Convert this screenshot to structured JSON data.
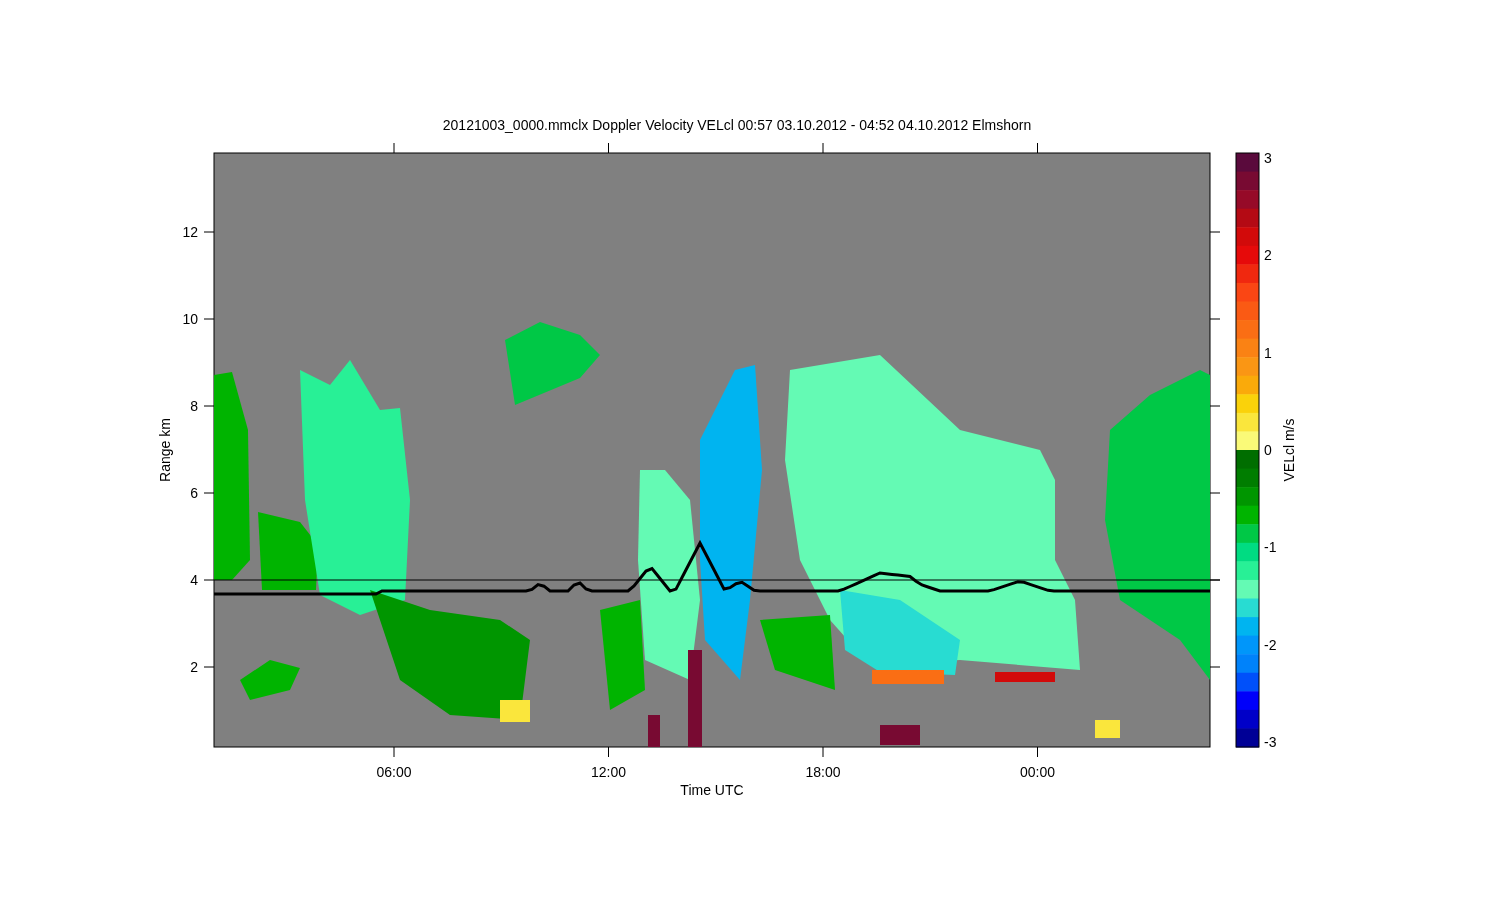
{
  "title": "20121003_0000.mmclx Doppler Velocity VELcl   00:57 03.10.2012 - 04:52 04.10.2012 Elmshorn",
  "y_axis": {
    "label": "Range km",
    "ticks": [
      "12",
      "10",
      "8",
      "6",
      "4",
      "2"
    ]
  },
  "x_axis": {
    "label": "Time UTC",
    "ticks": [
      "06:00",
      "12:00",
      "18:00",
      "00:00"
    ]
  },
  "colorbar": {
    "label": "VELcl m/s",
    "ticks": [
      "3",
      "2",
      "1",
      "0",
      "-1",
      "-2",
      "-3"
    ]
  }
}
